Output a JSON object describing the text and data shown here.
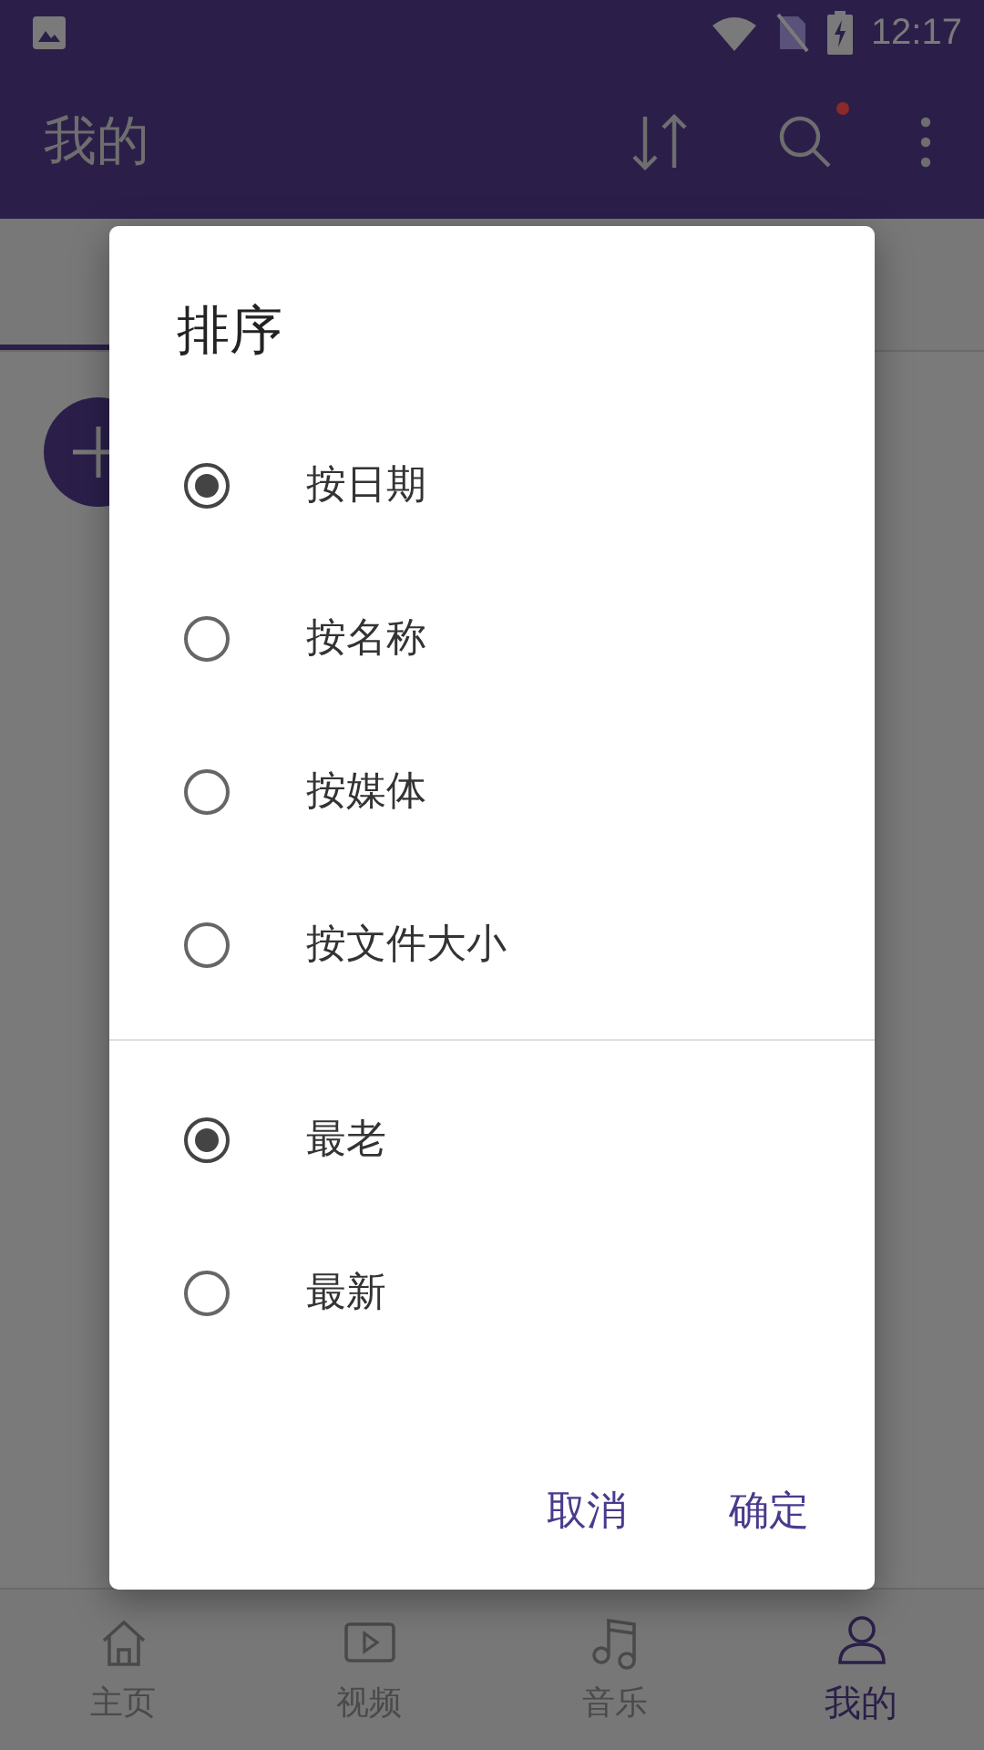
{
  "status_bar": {
    "time": "12:17"
  },
  "app_bar": {
    "title": "我的",
    "search_badge": true
  },
  "dialog": {
    "title": "排序",
    "sort_options": [
      {
        "label": "按日期",
        "selected": true
      },
      {
        "label": "按名称",
        "selected": false
      },
      {
        "label": "按媒体",
        "selected": false
      },
      {
        "label": "按文件大小",
        "selected": false
      }
    ],
    "order_options": [
      {
        "label": "最老",
        "selected": true
      },
      {
        "label": "最新",
        "selected": false
      }
    ],
    "buttons": [
      "取消",
      "确定"
    ]
  },
  "bottom_nav": [
    {
      "label": "主页",
      "kind": "home",
      "selected": false
    },
    {
      "label": "视频",
      "kind": "video",
      "selected": false
    },
    {
      "label": "音乐",
      "kind": "music",
      "selected": false
    },
    {
      "label": "我的",
      "kind": "person",
      "selected": true
    }
  ]
}
